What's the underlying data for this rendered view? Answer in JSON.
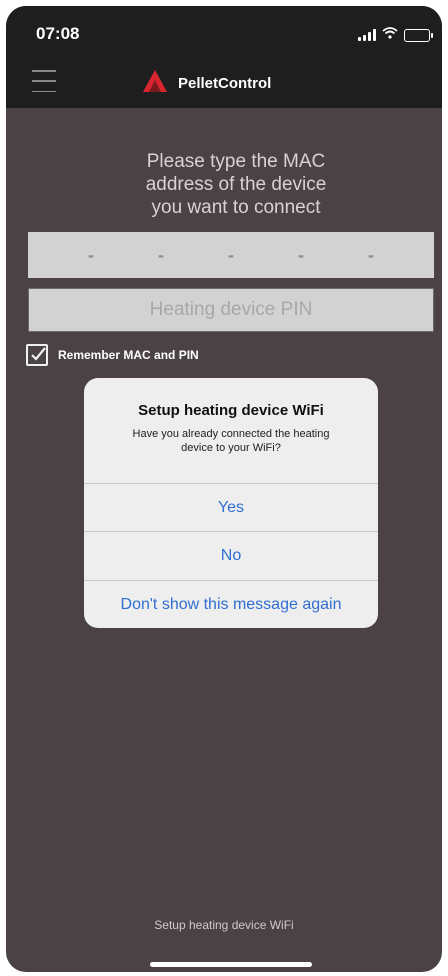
{
  "status_bar": {
    "time": "07:08",
    "signal_icon": "cellular-signal-icon",
    "wifi_icon": "wifi-icon",
    "battery_icon": "battery-charging-icon",
    "battery_color": "#6bd34a"
  },
  "header": {
    "menu_icon": "hamburger-menu-icon",
    "logo_icon": "pelletcontrol-logo-icon",
    "title": "PelletControl",
    "accent": "#d9252f"
  },
  "form": {
    "instruction_lines": [
      "Please type the MAC",
      "address of the device",
      "you want to connect"
    ],
    "mac_separators": [
      "-",
      "-",
      "-",
      "-",
      "-"
    ],
    "pin_placeholder": "Heating device PIN",
    "remember_label": "Remember MAC and PIN",
    "remember_checked": true
  },
  "dialog": {
    "title": "Setup heating device WiFi",
    "message": "Have you already connected the heating device to your WiFi?",
    "buttons": [
      "Yes",
      "No",
      "Don't show this message again"
    ],
    "button_color": "#2f6fd1"
  },
  "footer": {
    "label": "Setup heating device WiFi"
  }
}
